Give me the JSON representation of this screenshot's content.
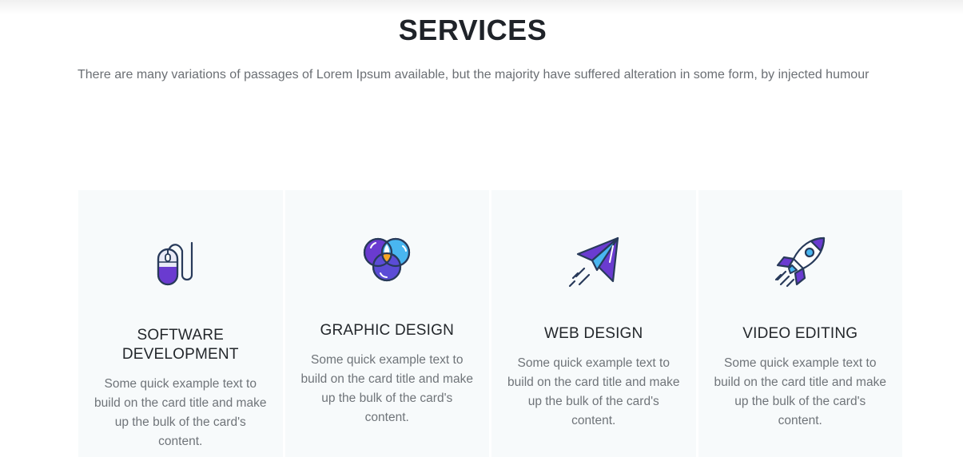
{
  "section": {
    "title": "SERVICES",
    "subtitle": "There are many variations of passages of Lorem Ipsum available, but the majority have suffered alteration in some form, by injected humour"
  },
  "cards": [
    {
      "icon": "computer-mouse-icon",
      "title": "SOFTWARE DEVELOPMENT",
      "text": "Some quick example text to build on the card title and make up the bulk of the card's content."
    },
    {
      "icon": "color-circles-icon",
      "title": "GRAPHIC DESIGN",
      "text": "Some quick example text to build on the card title and make up the bulk of the card's content."
    },
    {
      "icon": "paper-plane-icon",
      "title": "WEB DESIGN",
      "text": "Some quick example text to build on the card title and make up the bulk of the card's content."
    },
    {
      "icon": "rocket-icon",
      "title": "VIDEO EDITING",
      "text": "Some quick example text to build on the card title and make up the bulk of the card's content."
    }
  ],
  "colors": {
    "accent_purple": "#6a3bd0",
    "accent_blue": "#49b6f0",
    "accent_orange": "#f6a623",
    "outline": "#283a5a",
    "card_background": "#f7fafb"
  }
}
